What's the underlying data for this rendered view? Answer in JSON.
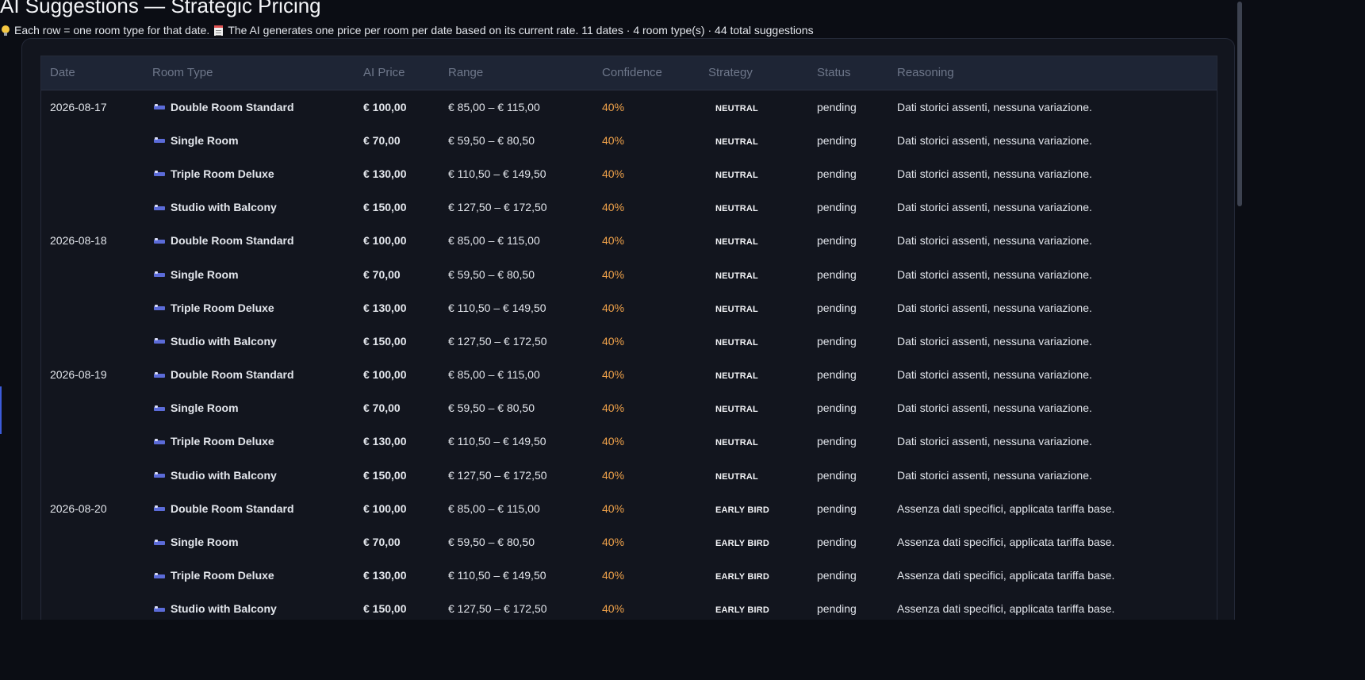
{
  "page": {
    "title": "AI Suggestions — Strategic Pricing",
    "hint": "Each row = one room type for that date.",
    "hint_detail": "The AI generates one price per room per date based on its current rate. 11 dates · 4 room type(s) · 44 total suggestions"
  },
  "icons": {
    "hint_icon": "lightbulb-icon",
    "detail_icon": "memo-icon",
    "room_icon": "bed-icon"
  },
  "colors": {
    "confidence": "#f0a24a",
    "header_bg": "#1e2535",
    "background": "#0b0d14"
  },
  "table": {
    "headers": [
      "Date",
      "Room Type",
      "AI Price",
      "Range",
      "Confidence",
      "Strategy",
      "Status",
      "Reasoning"
    ],
    "rows": [
      {
        "date": "2026-08-17",
        "room": "Double Room Standard",
        "price": "€ 100,00",
        "range": "€ 85,00 – € 115,00",
        "confidence": "40%",
        "strategy": "NEUTRAL",
        "status": "pending",
        "reasoning": "Dati storici assenti, nessuna variazione."
      },
      {
        "date": "",
        "room": "Single Room",
        "price": "€ 70,00",
        "range": "€ 59,50 – € 80,50",
        "confidence": "40%",
        "strategy": "NEUTRAL",
        "status": "pending",
        "reasoning": "Dati storici assenti, nessuna variazione."
      },
      {
        "date": "",
        "room": "Triple Room Deluxe",
        "price": "€ 130,00",
        "range": "€ 110,50 – € 149,50",
        "confidence": "40%",
        "strategy": "NEUTRAL",
        "status": "pending",
        "reasoning": "Dati storici assenti, nessuna variazione."
      },
      {
        "date": "",
        "room": "Studio with Balcony",
        "price": "€ 150,00",
        "range": "€ 127,50 – € 172,50",
        "confidence": "40%",
        "strategy": "NEUTRAL",
        "status": "pending",
        "reasoning": "Dati storici assenti, nessuna variazione."
      },
      {
        "date": "2026-08-18",
        "room": "Double Room Standard",
        "price": "€ 100,00",
        "range": "€ 85,00 – € 115,00",
        "confidence": "40%",
        "strategy": "NEUTRAL",
        "status": "pending",
        "reasoning": "Dati storici assenti, nessuna variazione."
      },
      {
        "date": "",
        "room": "Single Room",
        "price": "€ 70,00",
        "range": "€ 59,50 – € 80,50",
        "confidence": "40%",
        "strategy": "NEUTRAL",
        "status": "pending",
        "reasoning": "Dati storici assenti, nessuna variazione."
      },
      {
        "date": "",
        "room": "Triple Room Deluxe",
        "price": "€ 130,00",
        "range": "€ 110,50 – € 149,50",
        "confidence": "40%",
        "strategy": "NEUTRAL",
        "status": "pending",
        "reasoning": "Dati storici assenti, nessuna variazione."
      },
      {
        "date": "",
        "room": "Studio with Balcony",
        "price": "€ 150,00",
        "range": "€ 127,50 – € 172,50",
        "confidence": "40%",
        "strategy": "NEUTRAL",
        "status": "pending",
        "reasoning": "Dati storici assenti, nessuna variazione."
      },
      {
        "date": "2026-08-19",
        "room": "Double Room Standard",
        "price": "€ 100,00",
        "range": "€ 85,00 – € 115,00",
        "confidence": "40%",
        "strategy": "NEUTRAL",
        "status": "pending",
        "reasoning": "Dati storici assenti, nessuna variazione."
      },
      {
        "date": "",
        "room": "Single Room",
        "price": "€ 70,00",
        "range": "€ 59,50 – € 80,50",
        "confidence": "40%",
        "strategy": "NEUTRAL",
        "status": "pending",
        "reasoning": "Dati storici assenti, nessuna variazione."
      },
      {
        "date": "",
        "room": "Triple Room Deluxe",
        "price": "€ 130,00",
        "range": "€ 110,50 – € 149,50",
        "confidence": "40%",
        "strategy": "NEUTRAL",
        "status": "pending",
        "reasoning": "Dati storici assenti, nessuna variazione."
      },
      {
        "date": "",
        "room": "Studio with Balcony",
        "price": "€ 150,00",
        "range": "€ 127,50 – € 172,50",
        "confidence": "40%",
        "strategy": "NEUTRAL",
        "status": "pending",
        "reasoning": "Dati storici assenti, nessuna variazione."
      },
      {
        "date": "2026-08-20",
        "room": "Double Room Standard",
        "price": "€ 100,00",
        "range": "€ 85,00 – € 115,00",
        "confidence": "40%",
        "strategy": "EARLY BIRD",
        "status": "pending",
        "reasoning": "Assenza dati specifici, applicata tariffa base."
      },
      {
        "date": "",
        "room": "Single Room",
        "price": "€ 70,00",
        "range": "€ 59,50 – € 80,50",
        "confidence": "40%",
        "strategy": "EARLY BIRD",
        "status": "pending",
        "reasoning": "Assenza dati specifici, applicata tariffa base."
      },
      {
        "date": "",
        "room": "Triple Room Deluxe",
        "price": "€ 130,00",
        "range": "€ 110,50 – € 149,50",
        "confidence": "40%",
        "strategy": "EARLY BIRD",
        "status": "pending",
        "reasoning": "Assenza dati specifici, applicata tariffa base."
      },
      {
        "date": "",
        "room": "Studio with Balcony",
        "price": "€ 150,00",
        "range": "€ 127,50 – € 172,50",
        "confidence": "40%",
        "strategy": "EARLY BIRD",
        "status": "pending",
        "reasoning": "Assenza dati specifici, applicata tariffa base."
      }
    ]
  }
}
